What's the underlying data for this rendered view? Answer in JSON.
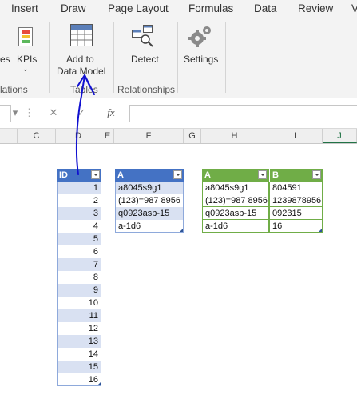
{
  "ribbon": {
    "tabs": [
      "Insert",
      "Draw",
      "Page Layout",
      "Formulas",
      "Data",
      "Review",
      "V"
    ],
    "buttons": {
      "partial_left": "es",
      "kpis": "KPIs",
      "add_to_data_model_line1": "Add to",
      "add_to_data_model_line2": "Data Model",
      "detect": "Detect",
      "settings": "Settings"
    },
    "groups": {
      "partial_relations": "lations",
      "tables": "Tables",
      "relationships": "Relationships"
    }
  },
  "formula_bar": {
    "cancel_glyph": "✕",
    "enter_glyph": "✓",
    "fx": "fx",
    "value": ""
  },
  "columns": [
    "C",
    "D",
    "E",
    "F",
    "G",
    "H",
    "I",
    "J"
  ],
  "table_id": {
    "header": "ID",
    "rows": [
      "1",
      "2",
      "3",
      "4",
      "5",
      "6",
      "7",
      "8",
      "9",
      "10",
      "11",
      "12",
      "13",
      "14",
      "15",
      "16"
    ]
  },
  "table_a": {
    "header": "A",
    "rows": [
      "a8045s9g1",
      "(123)=987 8956",
      "q0923asb-15",
      "a-1d6"
    ]
  },
  "table_ab": {
    "headers": [
      "A",
      "B"
    ],
    "rows": [
      [
        "a8045s9g1",
        "804591"
      ],
      [
        "(123)=987 8956",
        "1239878956"
      ],
      [
        "q0923asb-15",
        "092315"
      ],
      [
        "a-1d6",
        "16"
      ]
    ]
  },
  "colors": {
    "blue_header": "#4472c4",
    "blue_band": "#d9e1f2",
    "green_header": "#70ad47",
    "annotation": "#1010d0"
  }
}
